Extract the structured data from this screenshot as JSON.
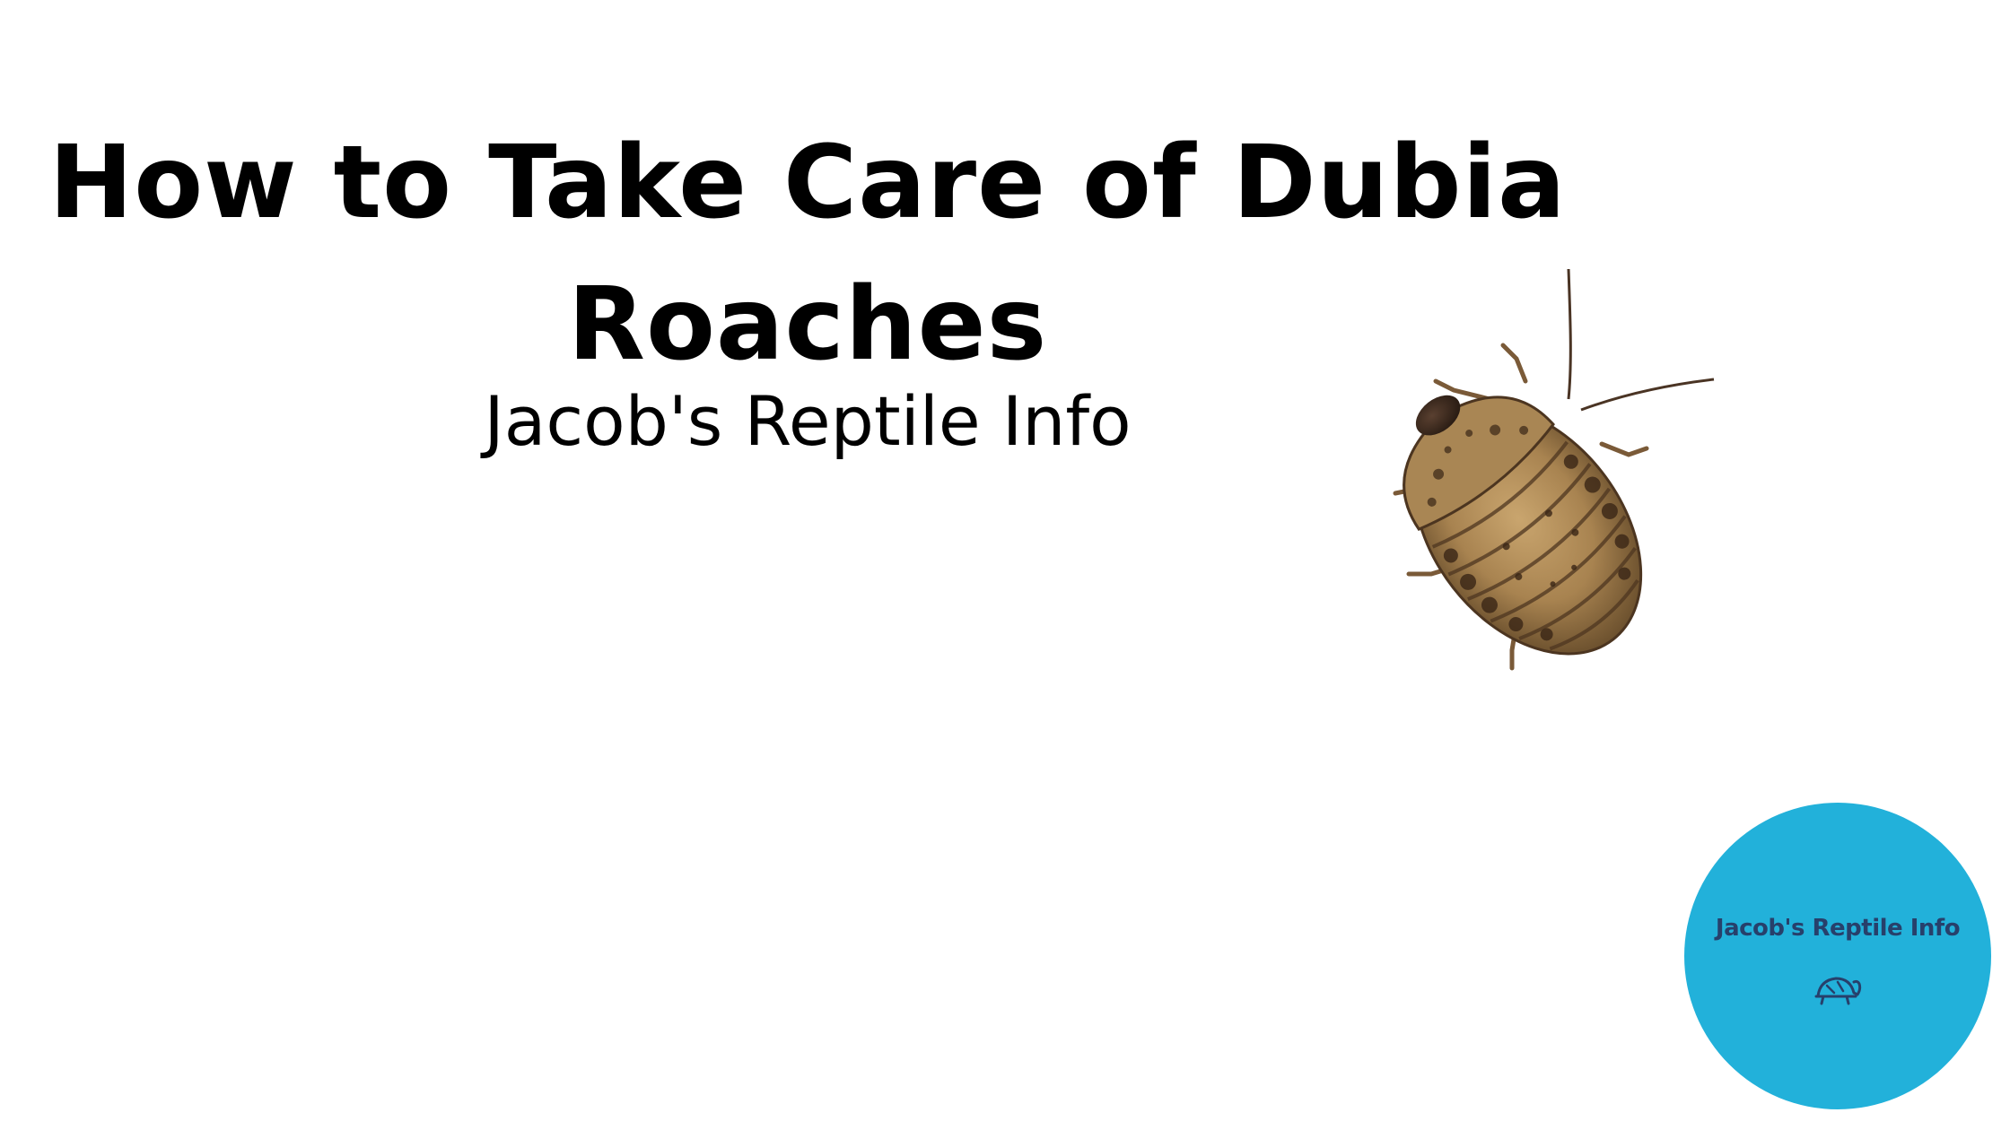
{
  "title": {
    "line1": "How to Take Care of Dubia",
    "line2": "Roaches"
  },
  "subtitle": "Jacob's Reptile Info",
  "logo": {
    "text": "Jacob's Reptile Info",
    "icon": "turtle-icon",
    "background_color": "#22b1da",
    "text_color": "#27406b"
  },
  "image": {
    "subject": "dubia-roach"
  }
}
